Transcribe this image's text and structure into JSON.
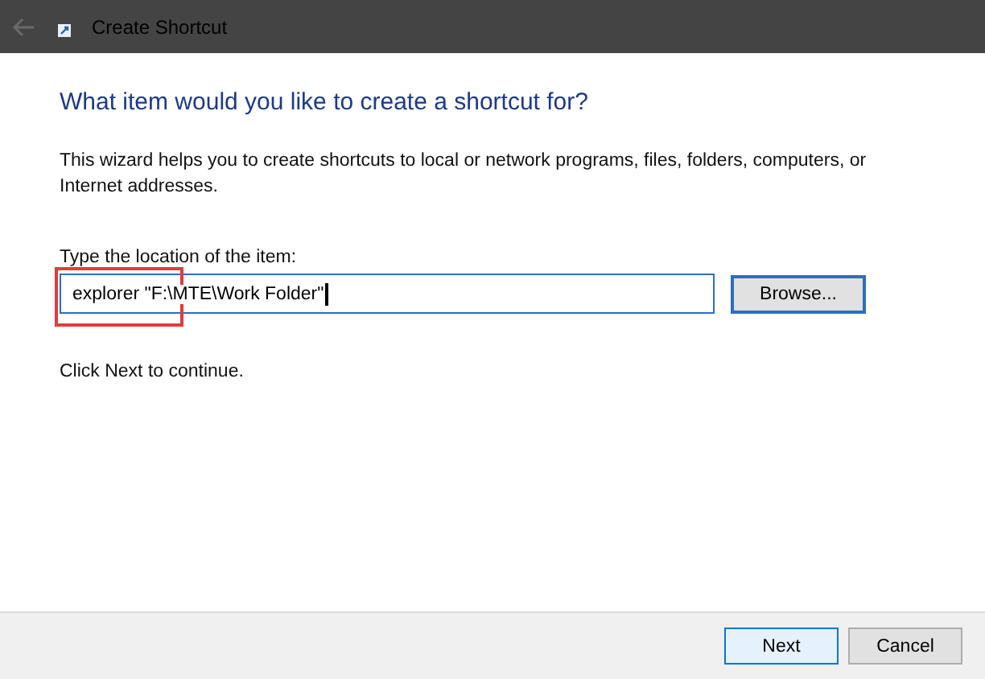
{
  "window": {
    "title": "Create Shortcut"
  },
  "heading": "What item would you like to create a shortcut for?",
  "description": "This wizard helps you to create shortcuts to local or network programs, files, folders, computers, or Internet addresses.",
  "location": {
    "label": "Type the location of the item:",
    "value": "explorer \"F:\\MTE\\Work Folder\"",
    "highlighted": true
  },
  "browse_button": "Browse...",
  "hint": "Click Next to continue.",
  "buttons": [
    {
      "label": "Next",
      "selected": true
    },
    {
      "label": "Cancel",
      "selected": false
    }
  ]
}
